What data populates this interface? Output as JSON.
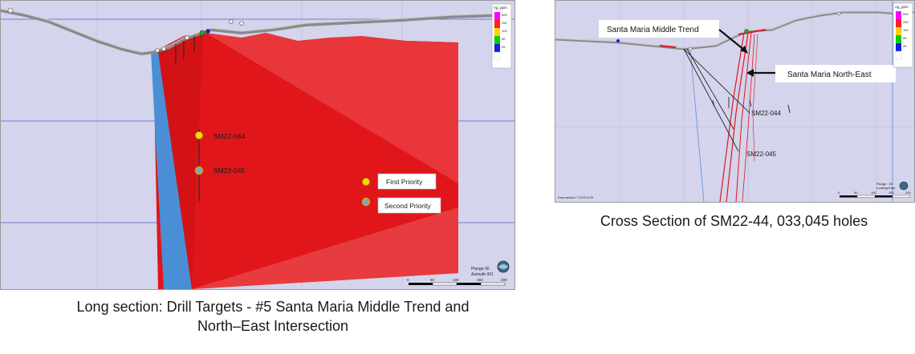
{
  "long_section": {
    "legend": {
      "title": "Ag_ppm",
      "items": [
        {
          "value": "500",
          "color": "#ff00ff"
        },
        {
          "value": "250",
          "color": "#ff2020"
        },
        {
          "value": "100",
          "color": "#ffd200"
        },
        {
          "value": "50",
          "color": "#00d000"
        },
        {
          "value": "25",
          "color": "#1020e0"
        },
        {
          "value": "",
          "color": "#ffffff"
        }
      ]
    },
    "targets": [
      {
        "label": "SM22-044",
        "priority": "first"
      },
      {
        "label": "SM22-045",
        "priority": "second"
      }
    ],
    "key": {
      "first_priority": "First Priority",
      "second_priority": "Second Priority"
    },
    "plunge_text": "Plunge 00",
    "azimuth_text": "Azimuth 001",
    "scale_ticks": [
      "0",
      "50",
      "100",
      "150",
      "200"
    ],
    "colors": {
      "background": "#d4d4ec",
      "zone_red": "#e0161a",
      "zone_blue": "#4a8fd6",
      "first_marker": "#f5d800",
      "second_marker": "#7aa3c8"
    }
  },
  "cross_section": {
    "legend": {
      "title": "Ag_ppm",
      "items": [
        {
          "value": "500",
          "color": "#ff00ff"
        },
        {
          "value": "250",
          "color": "#ff2020"
        },
        {
          "value": "100",
          "color": "#ffd200"
        },
        {
          "value": "50",
          "color": "#00d000"
        },
        {
          "value": "25",
          "color": "#1020e0"
        },
        {
          "value": "",
          "color": "#ffffff"
        }
      ]
    },
    "callouts": {
      "middle_trend": "Santa Maria Middle Trend",
      "north_east": "Santa Maria North-East"
    },
    "hole_labels": [
      "SM22-044",
      "SM22-045"
    ],
    "scale_ticks": [
      "0",
      "50",
      "100",
      "150",
      "200"
    ],
    "section_note": "East section +721074.23",
    "plunge_text": "Plunge : 00",
    "azimuth_text": "Looking East"
  },
  "captions": {
    "long_line1": "Long section: Drill Targets - #5  Santa Maria Middle Trend and",
    "long_line2": "North–East Intersection",
    "cross": "Cross Section of SM22-44, 033,045 holes"
  }
}
